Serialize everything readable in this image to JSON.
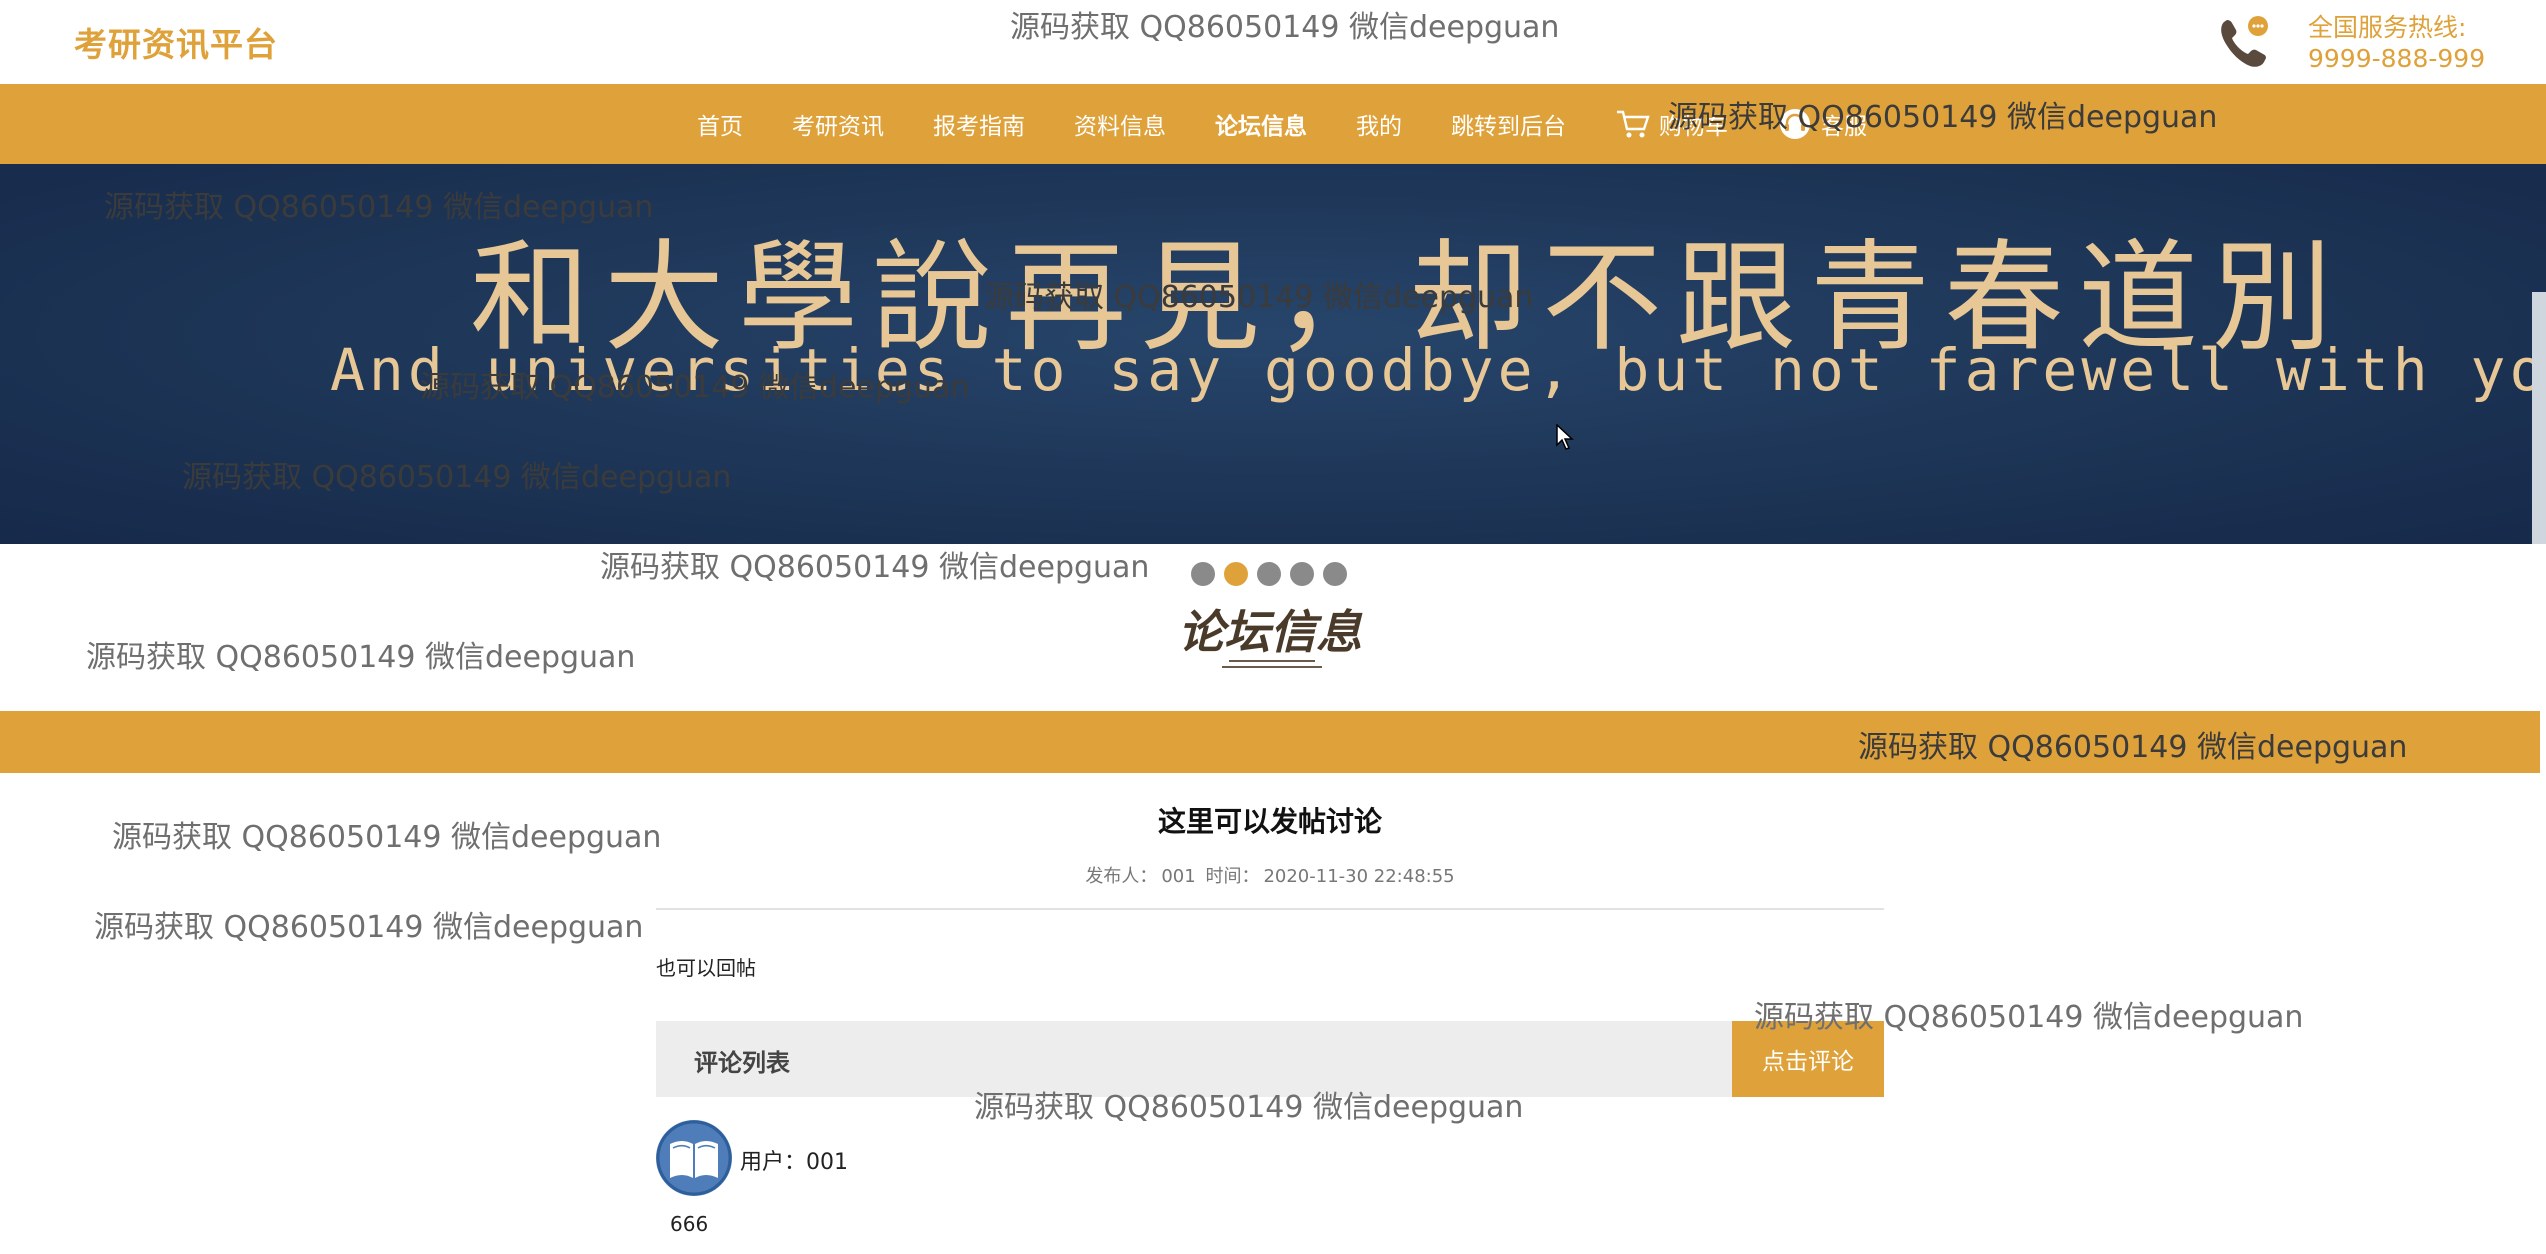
{
  "header": {
    "logo": "考研资讯平台",
    "hotline_label": "全国服务热线:",
    "hotline_number": "9999-888-999"
  },
  "nav": {
    "items": [
      {
        "label": "首页",
        "icon": ""
      },
      {
        "label": "考研资讯",
        "icon": ""
      },
      {
        "label": "报考指南",
        "icon": ""
      },
      {
        "label": "资料信息",
        "icon": ""
      },
      {
        "label": "论坛信息",
        "icon": "",
        "active": true
      },
      {
        "label": "我的",
        "icon": ""
      },
      {
        "label": "跳转到后台",
        "icon": ""
      },
      {
        "label": "购物车",
        "icon": "cart-icon"
      },
      {
        "label": "客服",
        "icon": "headset-icon"
      }
    ]
  },
  "banner": {
    "title": "和大學說再見，却不跟青春道別",
    "subtitle": "And universities to say goodbye, but not farewell with youth"
  },
  "carousel": {
    "count": 5,
    "active_index": 1
  },
  "section": {
    "title": "论坛信息"
  },
  "post": {
    "title": "这里可以发帖讨论",
    "publisher_label": "发布人：",
    "publisher": "001",
    "time_label": "时间：",
    "time": "2020-11-30 22:48:55",
    "content": "也可以回帖"
  },
  "comments": {
    "header": "评论列表",
    "button_label": "点击评论",
    "items": [
      {
        "user_label": "用户：",
        "user": "001",
        "content": "666"
      }
    ]
  },
  "watermark": "源码获取 QQ86050149 微信deepguan",
  "colors": {
    "accent": "#dfa23a",
    "banner_bg": "#1d3556",
    "banner_text": "#e7c795"
  }
}
